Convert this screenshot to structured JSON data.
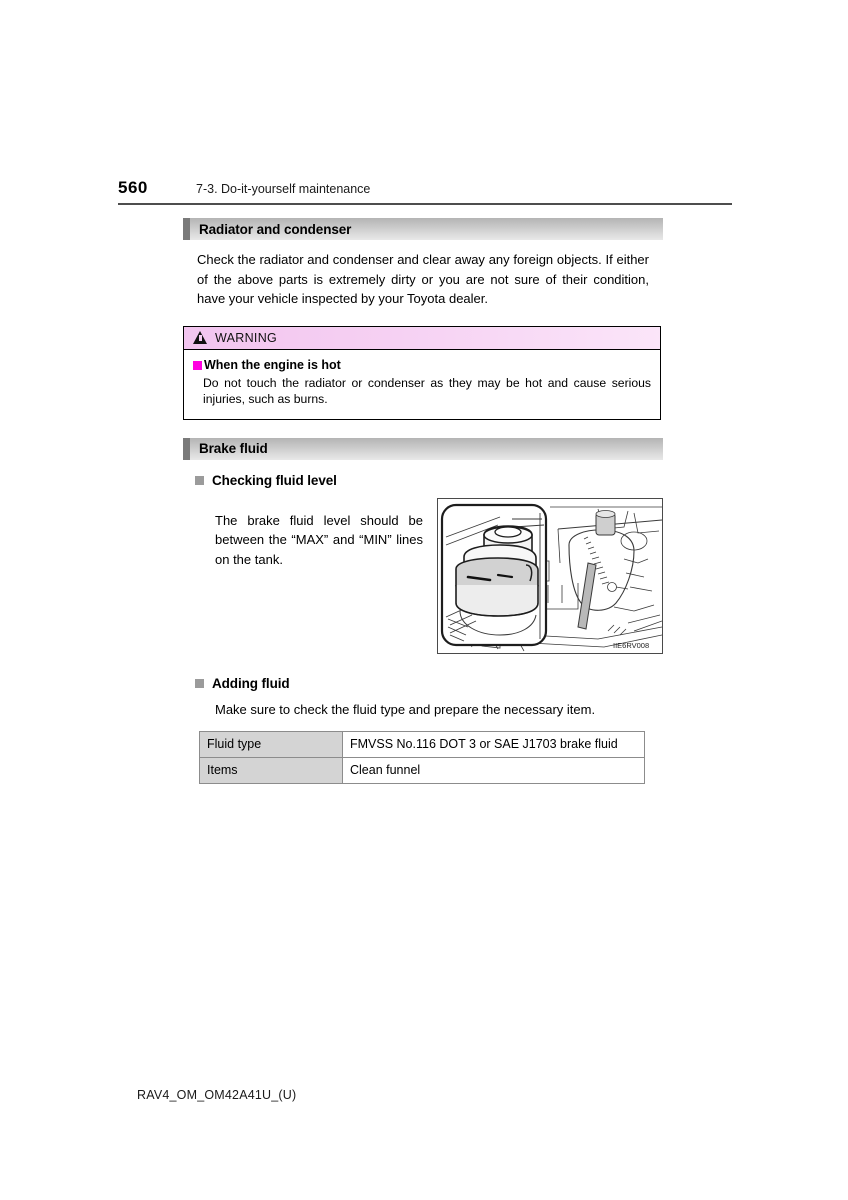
{
  "page": {
    "number": "560",
    "chapter": "7-3. Do-it-yourself maintenance",
    "footer_code": "RAV4_OM_OM42A41U_(U)"
  },
  "sections": [
    {
      "id": "radiator-and-condenser",
      "title": "Radiator and condenser",
      "paragraph": "Check the radiator and condenser and clear away any foreign objects. If either of the above parts is extremely dirty or you are not sure of their condition, have your vehicle inspected by your Toyota dealer."
    },
    {
      "id": "brake-fluid",
      "title": "Brake fluid"
    }
  ],
  "warning": {
    "label": "WARNING",
    "icon": "warning-triangle-icon",
    "subhead": "When the engine is hot",
    "body": "Do not touch the radiator or condenser as they may be hot and cause serious injuries, such as burns.",
    "header_color": "#f4cbf1",
    "bullet_color": "#ff00e0"
  },
  "checking_fluid_level": {
    "heading": "Checking fluid level",
    "text": "The brake fluid level should be between the “MAX” and “MIN” lines on the tank.",
    "illustration_code": "IIE6RV008",
    "illustration_alt": "brake-fluid-reservoir-engine-bay-illustration"
  },
  "adding_fluid": {
    "heading": "Adding fluid",
    "text": "Make sure to check the fluid type and prepare the necessary item.",
    "table": {
      "rows": [
        {
          "key": "Fluid type",
          "value": "FMVSS No.116 DOT 3 or SAE J1703 brake fluid"
        },
        {
          "key": "Items",
          "value": "Clean funnel"
        }
      ]
    }
  }
}
